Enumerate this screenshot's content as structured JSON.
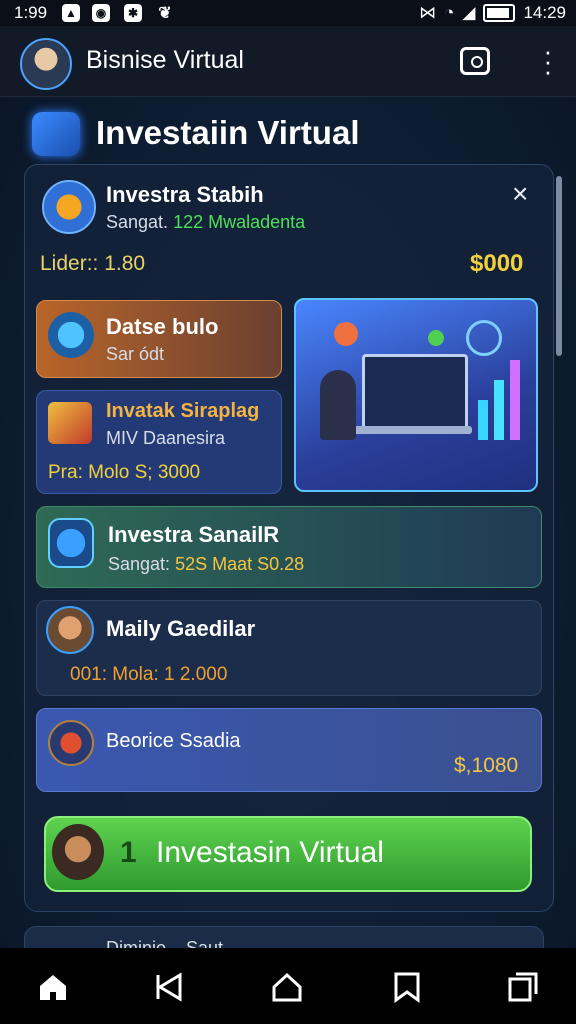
{
  "status_bar": {
    "time": "1:99",
    "time_right": "14:29"
  },
  "app_bar": {
    "title": "Bisnise Virtual"
  },
  "page": {
    "heading": "Investaiin Virtual"
  },
  "card_main": {
    "title": "Investra Stabih",
    "subtitle_prefix": "Sangat.",
    "subtitle_value": "122 Mwaladenta",
    "close": "×",
    "left_label": "Lider:: 1.80",
    "right_amount": "$000"
  },
  "card_orange": {
    "title": "Datse bulo",
    "subtitle": "Sar ódt"
  },
  "card_navy": {
    "title": "Invatak Siraplag",
    "subtitle": "MIV Daanesira",
    "footer": "Pra: Molo S; 3000"
  },
  "card_green": {
    "title": "Investra SanailR",
    "subtitle_prefix": "Sangat:",
    "subtitle_value": "52S Maat S0.28"
  },
  "card_profile": {
    "title": "Maily Gaedilar",
    "footer": "001: Mola: 1 2.000"
  },
  "card_blue": {
    "title": "Beorice Ssadia",
    "amount": "$,1080"
  },
  "cta": {
    "number": "1",
    "label": "Investasin Virtual"
  },
  "peek": {
    "label": "Diminio... Saut"
  }
}
